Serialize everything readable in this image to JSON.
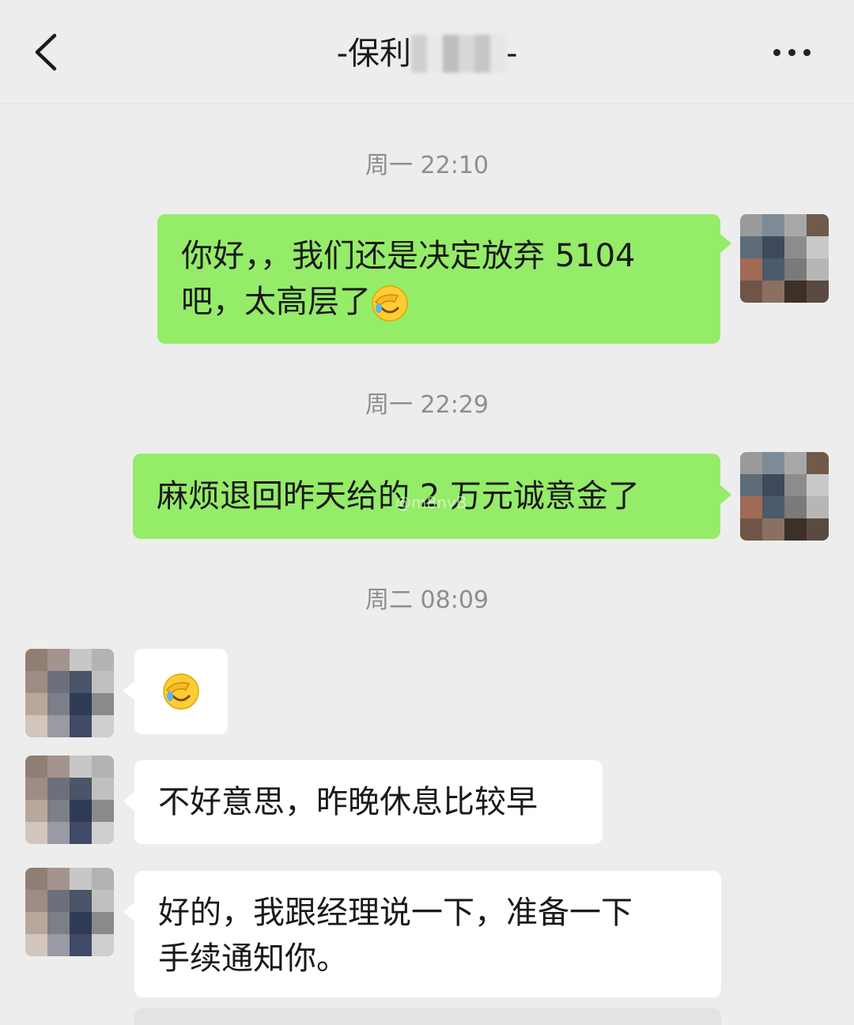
{
  "header": {
    "title_prefix": "-保利",
    "title_suffix": "-",
    "back_icon": "chevron-left-icon",
    "more_icon": "more-dots-icon"
  },
  "messages": [
    {
      "type": "time",
      "text": "周一 22:10"
    },
    {
      "type": "me",
      "line1": "你好，，我们还是决定放弃 5104",
      "line2": "吧，太高层了",
      "emoji": "facepalm-crying-emoji"
    },
    {
      "type": "time",
      "text": "周一 22:29"
    },
    {
      "type": "me",
      "text": "麻烦退回昨天给的 2 万元诚意金了"
    },
    {
      "type": "time",
      "text": "周二 08:09"
    },
    {
      "type": "them",
      "emoji": "facepalm-crying-emoji"
    },
    {
      "type": "them",
      "text": "不好意思，昨晚休息比较早"
    },
    {
      "type": "them",
      "line1": "好的，我跟经理说一下，准备一下",
      "line2": "手续通知你。"
    }
  ],
  "watermark": "@m8nvB",
  "colors": {
    "background": "#ededed",
    "my_bubble": "#95ec69",
    "their_bubble": "#ffffff",
    "timestamp": "#8e8e8e"
  }
}
